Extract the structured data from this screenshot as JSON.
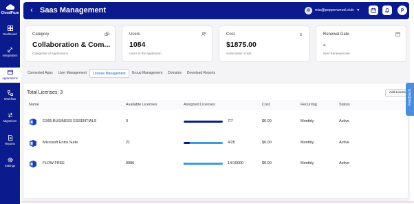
{
  "sidebar": {
    "brand": "CloudFuze",
    "items": [
      {
        "label": "Dashboard",
        "icon": "dashboard-icon"
      },
      {
        "label": "Integrations",
        "icon": "integrations-icon"
      },
      {
        "label": "Applications",
        "icon": "applications-icon",
        "active": true
      },
      {
        "label": "Workflow",
        "icon": "workflow-icon"
      },
      {
        "label": "Migrations",
        "icon": "migrations-icon"
      },
      {
        "label": "Reports",
        "icon": "reports-icon"
      },
      {
        "label": "Settings",
        "icon": "settings-icon"
      }
    ]
  },
  "header": {
    "back_icon": "‹",
    "title": "Saas Management",
    "user_email": "mia@pepperwood.club",
    "caret": "▼",
    "profile_initial": "p"
  },
  "cards": [
    {
      "label": "Category",
      "value": "Collaboration & Com...",
      "sub": "Categories of Applications",
      "icon": "link-icon"
    },
    {
      "label": "Users",
      "value": "1084",
      "sub": "Users in the application",
      "icon": "users-icon"
    },
    {
      "label": "Cost",
      "value": "$1875.00",
      "sub": "Subscription costs",
      "icon": "dollar-icon"
    },
    {
      "label": "Renewal Date",
      "value": "-",
      "sub": "Next Renewal Date",
      "icon": "calendar-icon"
    }
  ],
  "tabs": [
    {
      "label": "Connected Apps"
    },
    {
      "label": "User Management"
    },
    {
      "label": "License Management",
      "active": true
    },
    {
      "label": "Group Management"
    },
    {
      "label": "Domains"
    },
    {
      "label": "Download Reports"
    }
  ],
  "licenses": {
    "total_label": "Total Licenses: 3",
    "add_button": "Add License",
    "columns": [
      "Name",
      "Available Licenses",
      "Assigned Licenses",
      "Cost",
      "Recurring",
      "Status"
    ],
    "rows": [
      {
        "name": "O365 BUSINESS ESSENTIALS",
        "available": "0",
        "assigned": "7/7",
        "assigned_fraction": 1.0,
        "bar_color": "#0b1a8c",
        "cost": "$0.00",
        "recurring": "Monthly",
        "status": "Active"
      },
      {
        "name": "Microsoft Entra Suite",
        "available": "21",
        "assigned": "4/25",
        "assigned_fraction": 0.16,
        "bar_color": "#3a9bdc",
        "cost": "$0.00",
        "recurring": "Monthly",
        "status": "Active"
      },
      {
        "name": "FLOW FREE",
        "available": "9986",
        "assigned": "14/10000",
        "assigned_fraction": 0.0014,
        "bar_color": "#3a9bdc",
        "cost": "$0.00",
        "recurring": "Monthly",
        "status": "Active"
      }
    ]
  },
  "feedback_label": "Feedback",
  "colors": {
    "brand": "#0b1a8c",
    "accent": "#1565c0",
    "bar_light": "#3a9bdc"
  }
}
